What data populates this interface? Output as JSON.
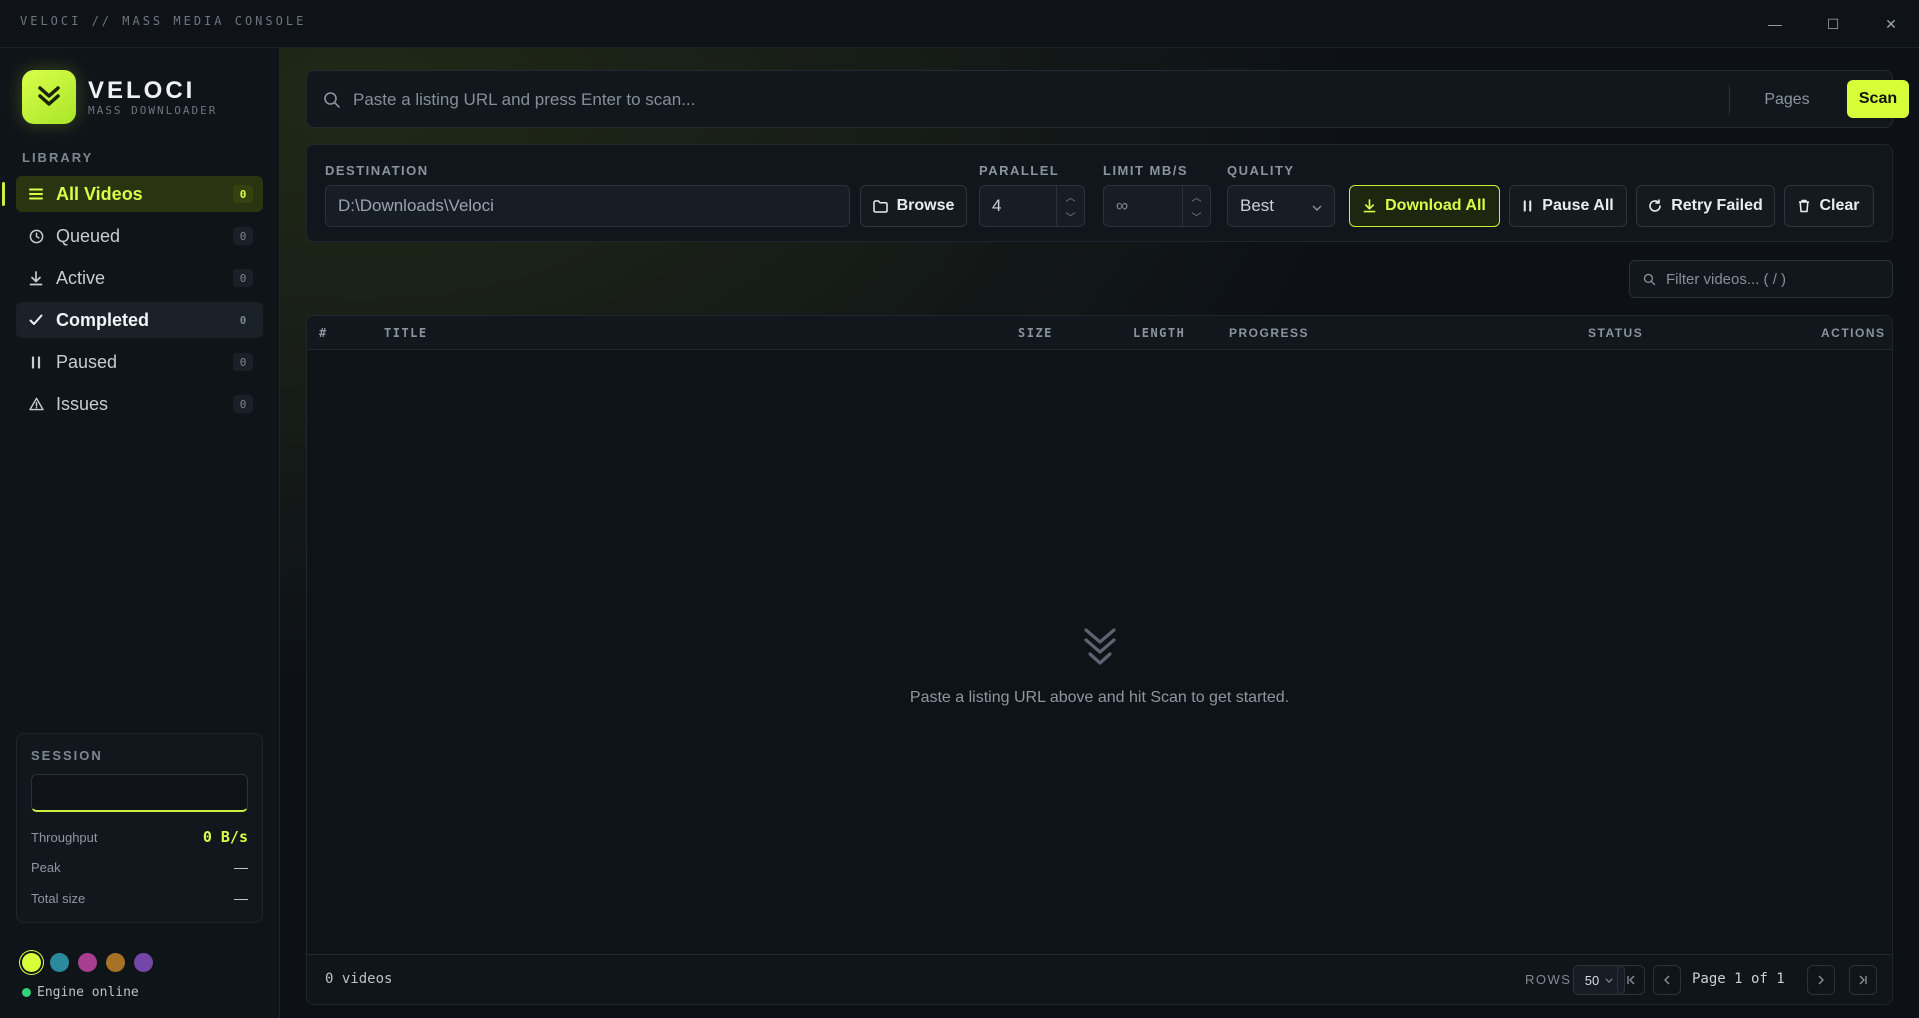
{
  "titlebar": {
    "title": "VELOCI // MASS MEDIA CONSOLE",
    "minimize": "—",
    "maximize": "☐",
    "close": "✕"
  },
  "brand": {
    "name": "VELOCI",
    "subtitle": "MASS DOWNLOADER"
  },
  "sidebar": {
    "section": "LIBRARY",
    "items": [
      {
        "label": "All Videos",
        "count": "0",
        "icon": "list-icon"
      },
      {
        "label": "Queued",
        "count": "0",
        "icon": "clock-icon"
      },
      {
        "label": "Active",
        "count": "0",
        "icon": "download-icon"
      },
      {
        "label": "Completed",
        "count": "0",
        "icon": "check-icon"
      },
      {
        "label": "Paused",
        "count": "0",
        "icon": "pause-icon"
      },
      {
        "label": "Issues",
        "count": "0",
        "icon": "warning-icon"
      }
    ]
  },
  "session": {
    "label": "SESSION",
    "throughput_label": "Throughput",
    "throughput": "0 B/s",
    "peak_label": "Peak",
    "peak": "—",
    "total_label": "Total size",
    "total": "—"
  },
  "themes": [
    "#d6ff3a",
    "#2b8a9c",
    "#a83e8f",
    "#a77226",
    "#7446a8"
  ],
  "engine": "Engine online",
  "scan": {
    "placeholder": "Paste a listing URL and press Enter to scan...",
    "pages": "Pages",
    "scan": "Scan"
  },
  "controls": {
    "destination_label": "DESTINATION",
    "destination_value": "D:\\Downloads\\Veloci",
    "browse": "Browse",
    "parallel_label": "PARALLEL",
    "parallel_value": "4",
    "limit_label": "LIMIT MB/S",
    "limit_placeholder": "∞",
    "quality_label": "QUALITY",
    "quality_value": "Best",
    "download_all": "Download All",
    "pause_all": "Pause All",
    "retry_failed": "Retry Failed",
    "clear": "Clear"
  },
  "filter": {
    "placeholder": "Filter videos... ( / )"
  },
  "table": {
    "columns": [
      "#",
      "TITLE",
      "SIZE",
      "LENGTH",
      "PROGRESS",
      "STATUS",
      "ACTIONS"
    ],
    "empty": "Paste a listing URL above and hit Scan to get started."
  },
  "footer": {
    "count": "0 videos",
    "rows_label": "ROWS",
    "rows_value": "50",
    "page": "Page 1 of 1"
  },
  "colors": {
    "accent": "#d6ff3a",
    "background": "#0d1117",
    "online": "#33d17a"
  }
}
